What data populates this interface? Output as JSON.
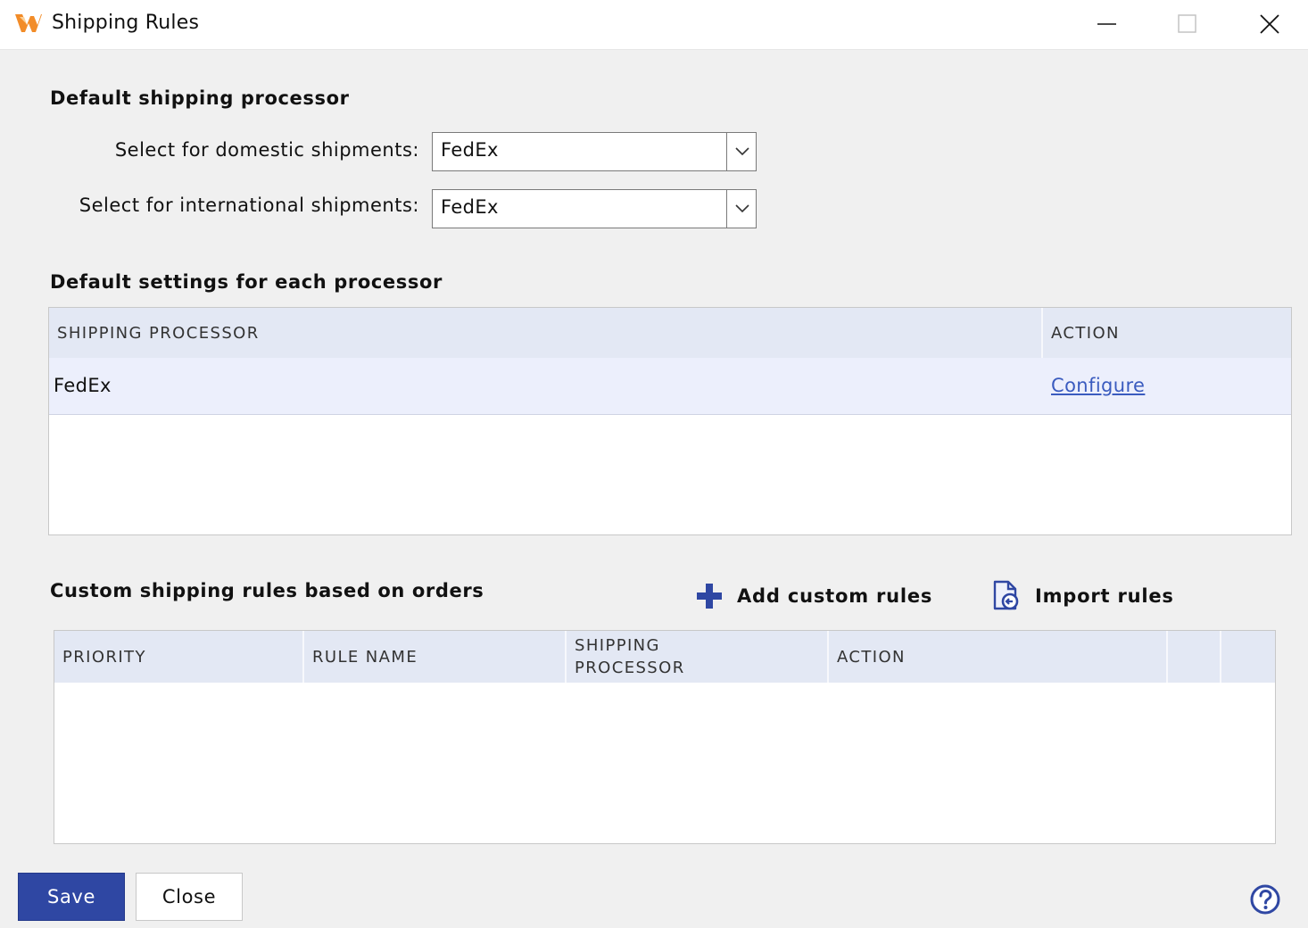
{
  "window": {
    "title": "Shipping Rules"
  },
  "default_processor": {
    "heading": "Default shipping processor",
    "domestic_label": "Select for domestic shipments:",
    "domestic_value": "FedEx",
    "international_label": "Select for international shipments:",
    "international_value": "FedEx"
  },
  "processor_settings": {
    "heading": "Default settings for each processor",
    "columns": [
      "SHIPPING PROCESSOR",
      "ACTION"
    ],
    "rows": [
      {
        "processor": "FedEx",
        "action": "Configure"
      }
    ]
  },
  "custom_rules": {
    "heading": "Custom shipping rules based on orders",
    "add_label": "Add custom rules",
    "import_label": "Import rules",
    "columns": [
      "PRIORITY",
      "RULE NAME",
      "SHIPPING PROCESSOR",
      "ACTION"
    ]
  },
  "footer": {
    "save_label": "Save",
    "close_label": "Close"
  },
  "icons": {
    "logo": "app-logo-icon",
    "minimize": "minimize-icon",
    "maximize": "maximize-icon",
    "close": "close-icon",
    "dropdown": "chevron-down-icon",
    "add": "plus-icon",
    "import": "import-file-icon",
    "help": "help-icon"
  },
  "colors": {
    "primary": "#2f47a3",
    "header_bg": "#e3e8f4",
    "row_bg": "#eceffc",
    "link": "#3a5bbf",
    "logo": "#f28c28"
  }
}
